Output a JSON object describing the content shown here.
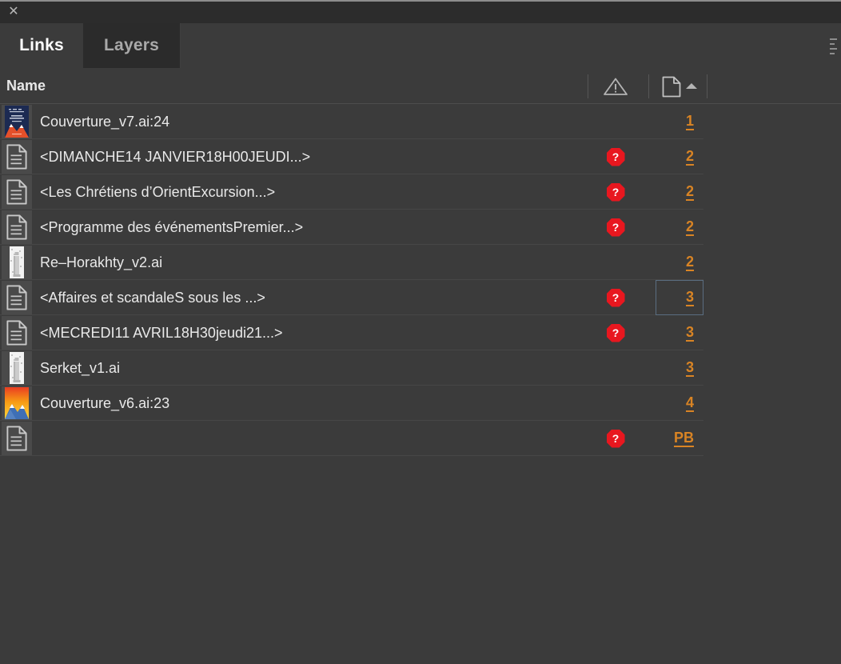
{
  "window": {
    "close_label": "✕",
    "close_icon": "close-icon"
  },
  "tabs": [
    {
      "label": "Links",
      "active": true
    },
    {
      "label": "Layers",
      "active": false
    }
  ],
  "panel_menu": {
    "icon": "panel-menu-icon"
  },
  "columns": {
    "name_label": "Name",
    "warning_header_icon": "warning-triangle-icon",
    "page_header_icon": "page-icon",
    "sort_indicator_icon": "sort-ascending-icon",
    "sort_direction": "ascending"
  },
  "colors": {
    "panel_bg": "#3b3b3b",
    "tabstrip_bg": "#2b2b2b",
    "titlebar_bg": "#2c2c2c",
    "row_divider": "#464646",
    "page_number": "#d98424",
    "missing_badge": "#e8171f",
    "text": "#e9e9e9",
    "focus_outline": "#5a6d80"
  },
  "rows": [
    {
      "name": "Couverture_v7.ai:24",
      "page": "1",
      "missing": false,
      "thumb": "cover-blue-mountains",
      "focused": false
    },
    {
      "name": "<DIMANCHE14 JANVIER18H00JEUDI...>",
      "page": "2",
      "missing": true,
      "thumb": "placed-text-icon",
      "focused": false
    },
    {
      "name": "<Les Chrétiens d’OrientExcursion...>",
      "page": "2",
      "missing": true,
      "thumb": "placed-text-icon",
      "focused": false
    },
    {
      "name": "<Programme des événementsPremier...>",
      "page": "2",
      "missing": true,
      "thumb": "placed-text-icon",
      "focused": false
    },
    {
      "name": "Re–Horakhty_v2.ai",
      "page": "2",
      "missing": false,
      "thumb": "statue-grayscale",
      "focused": false
    },
    {
      "name": "<Affaires et scandaleS sous les ...>",
      "page": "3",
      "missing": true,
      "thumb": "placed-text-icon",
      "focused": true
    },
    {
      "name": "<MECREDI11 AVRIL18H30jeudi21...>",
      "page": "3",
      "missing": true,
      "thumb": "placed-text-icon",
      "focused": false
    },
    {
      "name": "Serket_v1.ai",
      "page": "3",
      "missing": false,
      "thumb": "statue-grayscale",
      "focused": false
    },
    {
      "name": "Couverture_v6.ai:23",
      "page": "4",
      "missing": false,
      "thumb": "cover-orange-sunset",
      "focused": false
    },
    {
      "name": "",
      "page": "PB",
      "missing": true,
      "thumb": "placed-text-icon",
      "focused": false
    }
  ]
}
